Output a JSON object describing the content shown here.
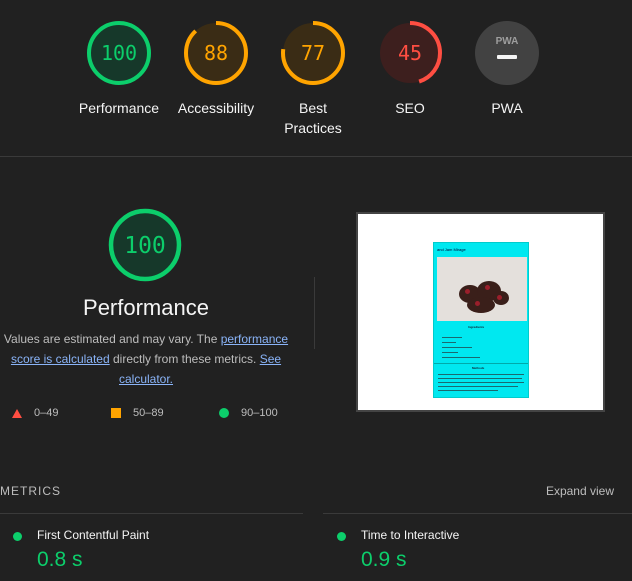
{
  "gauges": [
    {
      "value": "100",
      "label": "Performance",
      "color": "#0cce6b",
      "track": "#16382a",
      "fraction": 1.0
    },
    {
      "value": "88",
      "label": "Accessibility",
      "color": "#ffa400",
      "track": "#3a2c15",
      "fraction": 0.88
    },
    {
      "value": "77",
      "label": "Best Practices",
      "color": "#ffa400",
      "track": "#3a2c15",
      "fraction": 0.77
    },
    {
      "value": "45",
      "label": "SEO",
      "color": "#ff4e42",
      "track": "#3d1f1e",
      "fraction": 0.45
    },
    {
      "value": "PWA",
      "label": "PWA",
      "color": "#9e9e9e",
      "track": "#424242",
      "fraction": 0
    }
  ],
  "performance": {
    "score": "100",
    "title": "Performance",
    "desc_prefix": "Values are estimated and may vary. The ",
    "link1": "performance score is calculated",
    "desc_middle": " directly from these metrics. ",
    "link2": "See calculator.",
    "legend": {
      "fail": "0–49",
      "average": "50–89",
      "pass": "90–100"
    }
  },
  "screenshot": {
    "page_title": "and Jam Mirage",
    "section1": "Ingredients",
    "section2": "Methods"
  },
  "metrics": {
    "header": "METRICS",
    "expand": "Expand view",
    "items": [
      {
        "name": "First Contentful Paint",
        "value": "0.8 s"
      },
      {
        "name": "Time to Interactive",
        "value": "0.9 s"
      }
    ]
  },
  "colors": {
    "pass": "#0cce6b",
    "average": "#ffa400",
    "fail": "#ff4e42",
    "link": "#8ab4f8"
  }
}
